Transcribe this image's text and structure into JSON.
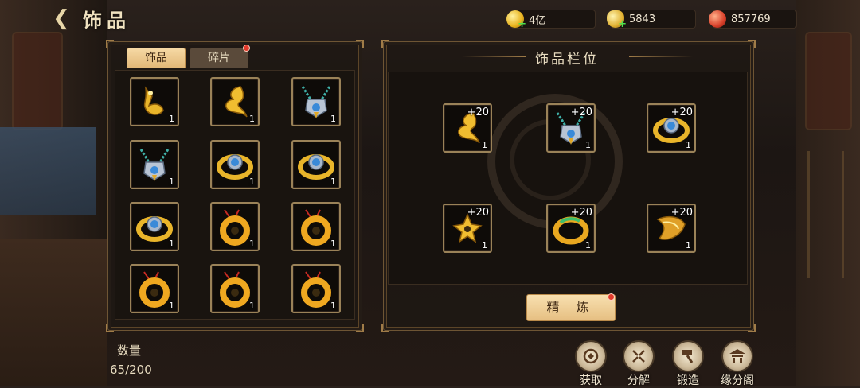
{
  "header": {
    "title": "饰品",
    "back_icon": "back-arrow-icon"
  },
  "currencies": [
    {
      "icon": "gold-coin-icon",
      "value": "4亿"
    },
    {
      "icon": "gold-ingot-icon",
      "value": "5843"
    },
    {
      "icon": "red-token-icon",
      "value": "857769"
    }
  ],
  "tabs": [
    {
      "label": "饰品",
      "active": true
    },
    {
      "label": "碎片",
      "active": false,
      "badge": true
    }
  ],
  "inventory": [
    {
      "item": "gold-charm-icon",
      "count": "1"
    },
    {
      "item": "gold-swirl-icon",
      "count": "1"
    },
    {
      "item": "silver-pendant-icon",
      "count": "1"
    },
    {
      "item": "silver-pendant-icon",
      "count": "1"
    },
    {
      "item": "gold-ring-icon",
      "count": "1"
    },
    {
      "item": "gold-ring-icon",
      "count": "1"
    },
    {
      "item": "gold-ring-icon",
      "count": "1"
    },
    {
      "item": "gold-coil-pendant-icon",
      "count": "1"
    },
    {
      "item": "gold-coil-pendant-icon",
      "count": "1"
    },
    {
      "item": "gold-coil-pendant-icon",
      "count": "1"
    },
    {
      "item": "gold-coil-pendant-icon",
      "count": "1"
    },
    {
      "item": "gold-coil-pendant-icon",
      "count": "1"
    }
  ],
  "equipped": {
    "title": "饰品栏位",
    "slots": [
      {
        "item": "gold-swirl-icon",
        "level": "+20",
        "count": "1"
      },
      {
        "item": "silver-pendant-icon",
        "level": "+20",
        "count": "1"
      },
      {
        "item": "gold-ring-icon",
        "level": "+20",
        "count": "1"
      },
      {
        "item": "gold-flower-icon",
        "level": "+20",
        "count": "1"
      },
      {
        "item": "jade-bracelet-icon",
        "level": "+20",
        "count": "1"
      },
      {
        "item": "gold-cuff-icon",
        "level": "+20",
        "count": "1"
      }
    ],
    "refine_label": "精 炼",
    "refine_badge": true
  },
  "quantity": {
    "label": "数量",
    "value": "65/200"
  },
  "actions": [
    {
      "label": "获取",
      "icon": "obtain-icon"
    },
    {
      "label": "分解",
      "icon": "decompose-icon"
    },
    {
      "label": "锻造",
      "icon": "forge-hammer-icon"
    },
    {
      "label": "缘分阁",
      "icon": "pavilion-icon"
    }
  ]
}
